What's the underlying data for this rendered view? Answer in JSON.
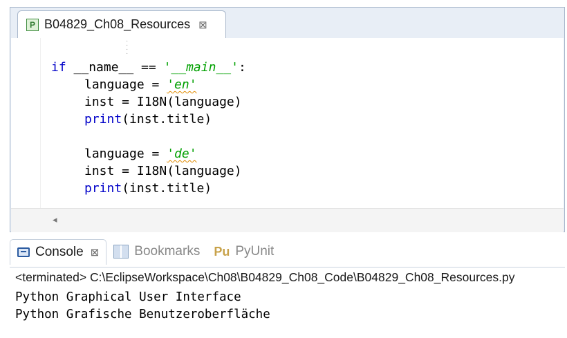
{
  "editor": {
    "tab": {
      "label": "B04829_Ch08_Resources",
      "icon": "python-file-icon"
    },
    "code": {
      "line1": {
        "kw": "if",
        "mid": " __name__ == ",
        "str": "'__main__'",
        "end": ":"
      },
      "line2": {
        "pre": "language = ",
        "str": "'en'"
      },
      "line3": "inst = I18N(language)",
      "line4": {
        "kw": "print",
        "rest": "(inst.title)"
      },
      "line5": {
        "pre": "language = ",
        "str": "'de'"
      },
      "line6": "inst = I18N(language)",
      "line7": {
        "kw": "print",
        "rest": "(inst.title)"
      }
    }
  },
  "console": {
    "tabs": [
      {
        "label": "Console",
        "icon": "console-icon",
        "active": true
      },
      {
        "label": "Bookmarks",
        "icon": "bookmarks-icon",
        "active": false
      },
      {
        "label": "PyUnit",
        "icon": "pyunit-icon",
        "active": false
      }
    ],
    "status": "<terminated> C:\\EclipseWorkspace\\Ch08\\B04829_Ch08_Code\\B04829_Ch08_Resources.py",
    "output": [
      "Python Graphical User Interface",
      "Python Grafische Benutzeroberfläche"
    ]
  },
  "colors": {
    "keyword": "#0000c8",
    "string": "#00a000",
    "frame": "#e8eef6"
  }
}
